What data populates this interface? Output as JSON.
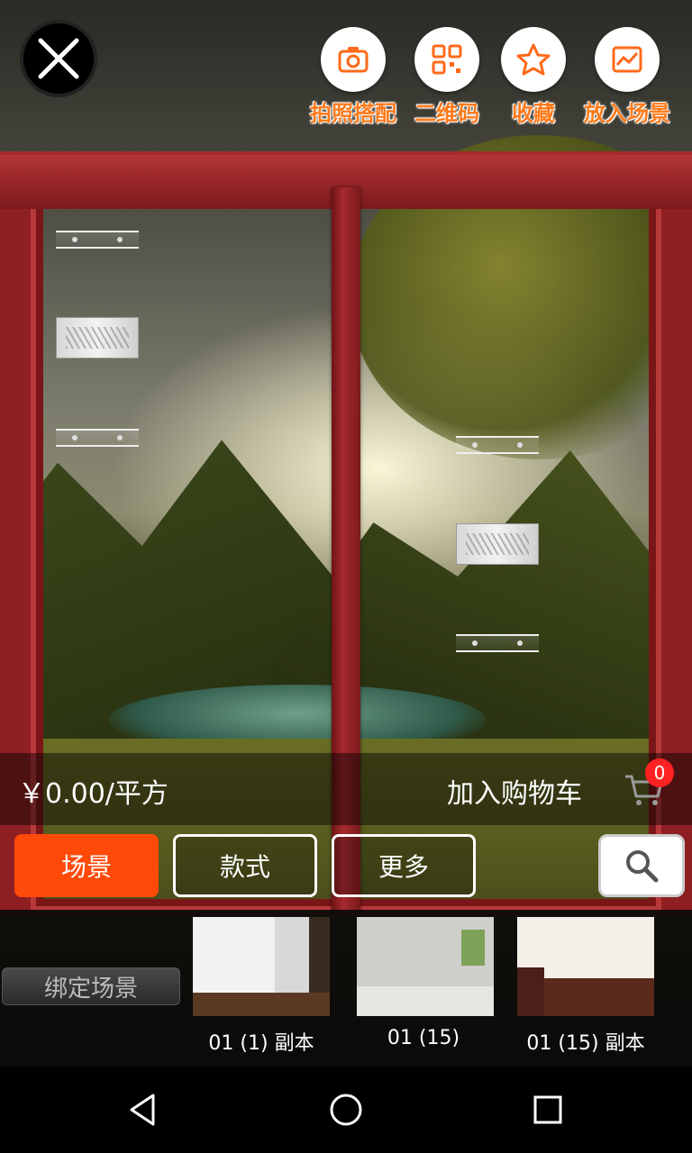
{
  "top_actions": [
    {
      "label": "拍照搭配",
      "icon": "camera-icon"
    },
    {
      "label": "二维码",
      "icon": "qrcode-icon"
    },
    {
      "label": "收藏",
      "icon": "star-icon"
    },
    {
      "label": "放入场景",
      "icon": "scene-icon"
    }
  ],
  "price_bar": {
    "price": "￥0.00/平方",
    "add_to_cart": "加入购物车",
    "cart_count": "0"
  },
  "tabs": [
    {
      "label": "场景",
      "active": true
    },
    {
      "label": "款式",
      "active": false
    },
    {
      "label": "更多",
      "active": false
    }
  ],
  "bind_scene_label": "绑定场景",
  "scenes": [
    {
      "caption": "01 (1) 副本"
    },
    {
      "caption": "01 (15)"
    },
    {
      "caption": "01 (15) 副本"
    }
  ],
  "colors": {
    "accent": "#ff4a0a",
    "action_label": "#ff7a1a",
    "frame": "#8e1f22",
    "badge": "#ff2222"
  }
}
